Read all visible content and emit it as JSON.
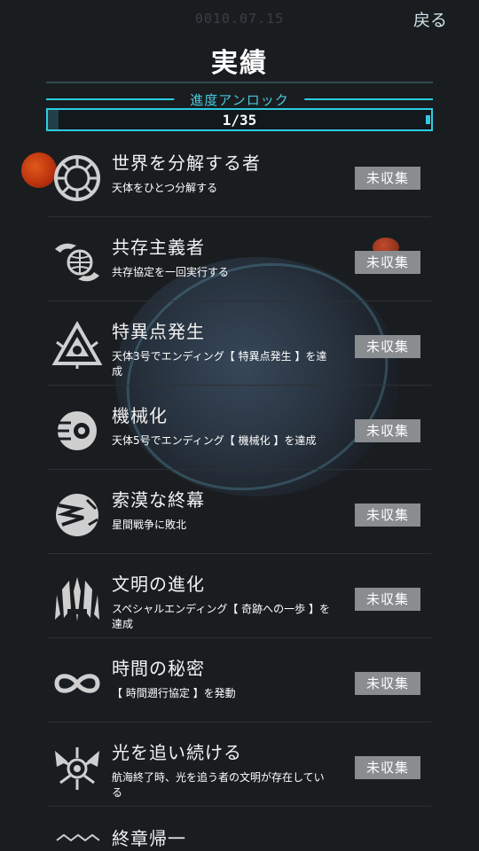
{
  "header": {
    "clock": "0010.07.15",
    "back_label": "戻る",
    "title": "実績"
  },
  "progress": {
    "label": "進度アンロック",
    "value": "1/35",
    "fraction": 0.0286
  },
  "achievements": [
    {
      "name": "世界を分解する者",
      "desc": "天体をひとつ分解する",
      "status": "未収集",
      "icon": "disintegrate-icon"
    },
    {
      "name": "共存主義者",
      "desc": "共存協定を一回実行する",
      "status": "未収集",
      "icon": "coexist-icon"
    },
    {
      "name": "特異点発生",
      "desc": "天体3号でエンディング【 特異点発生 】を達成",
      "status": "未収集",
      "icon": "singularity-icon"
    },
    {
      "name": "機械化",
      "desc": "天体5号でエンディング【 機械化 】を達成",
      "status": "未収集",
      "icon": "mechanization-icon"
    },
    {
      "name": "索漠な終幕",
      "desc": "星間戦争に敗北",
      "status": "未収集",
      "icon": "desolate-end-icon"
    },
    {
      "name": "文明の進化",
      "desc": "スペシャルエンディング【 奇跡への一歩 】を達成",
      "status": "未収集",
      "icon": "evolution-icon"
    },
    {
      "name": "時間の秘密",
      "desc": "【 時間遡行協定 】を発動",
      "status": "未収集",
      "icon": "infinity-icon"
    },
    {
      "name": "光を追い続ける",
      "desc": "航海終了時、光を追う者の文明が存在している",
      "status": "未収集",
      "icon": "light-chaser-icon"
    }
  ],
  "partial_item": {
    "name": "終章帰一",
    "icon": "final-chapter-icon"
  }
}
